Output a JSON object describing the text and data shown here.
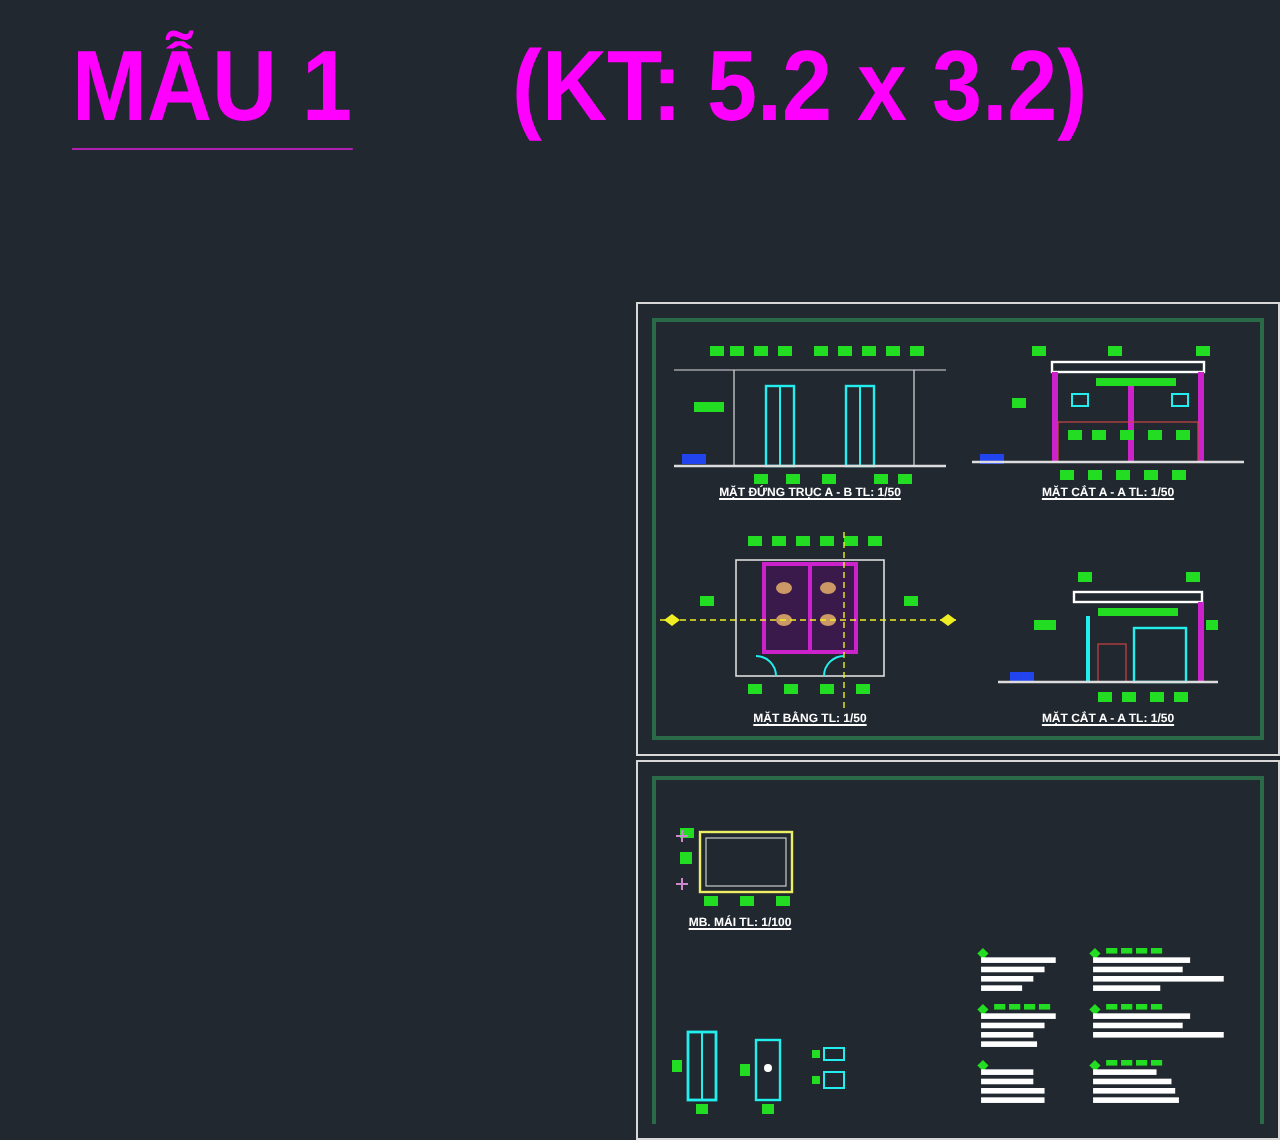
{
  "title": {
    "label": "MẪU 1",
    "dimensions": "(KT: 5.2 x 3.2)"
  },
  "sheets": [
    {
      "views": [
        {
          "kind": "elevation",
          "caption": "MẶT ĐỨNG TRỤC A - B TL: 1/50"
        },
        {
          "kind": "section",
          "caption": "MẶT CẮT A - A TL: 1/50"
        },
        {
          "kind": "plan",
          "caption": "MẶT BẰNG TL: 1/50"
        },
        {
          "kind": "section2",
          "caption": "MẶT CẮT A - A TL: 1/50"
        }
      ]
    },
    {
      "views": [
        {
          "kind": "roof",
          "caption": "MB. MÁI TL: 1/100"
        },
        {
          "kind": "doors"
        },
        {
          "kind": "notes"
        }
      ]
    }
  ]
}
